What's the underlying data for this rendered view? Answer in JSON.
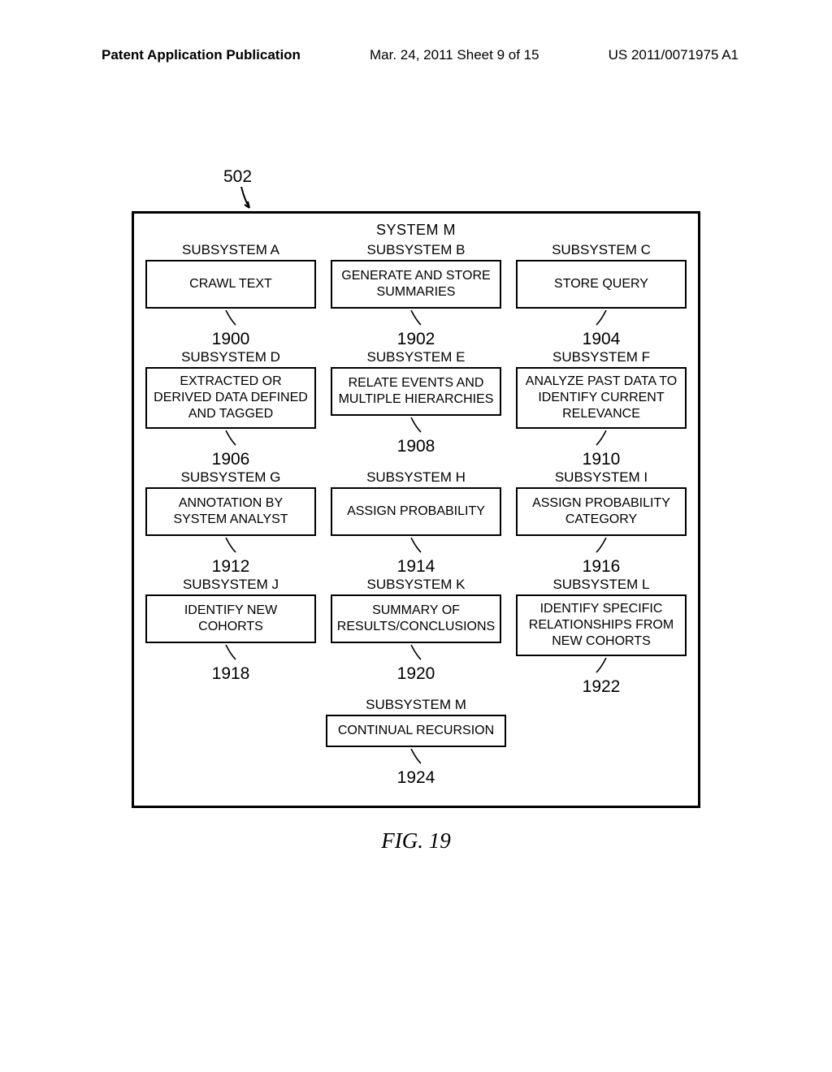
{
  "header": {
    "left": "Patent Application Publication",
    "center": "Mar. 24, 2011  Sheet 9 of 15",
    "right": "US 2011/0071975 A1"
  },
  "top_ref": "502",
  "system_title": "SYSTEM M",
  "rows": [
    [
      {
        "title": "SUBSYSTEM A",
        "body": "CRAWL TEXT",
        "ref": "1900",
        "dir": "left"
      },
      {
        "title": "SUBSYSTEM B",
        "body": "GENERATE AND STORE SUMMARIES",
        "ref": "1902",
        "dir": "left"
      },
      {
        "title": "SUBSYSTEM C",
        "body": "STORE QUERY",
        "ref": "1904",
        "dir": "right"
      }
    ],
    [
      {
        "title": "SUBSYSTEM D",
        "body": "EXTRACTED OR DERIVED DATA DEFINED AND TAGGED",
        "ref": "1906",
        "dir": "left"
      },
      {
        "title": "SUBSYSTEM E",
        "body": "RELATE EVENTS AND MULTIPLE HIERARCHIES",
        "ref": "1908",
        "dir": "left"
      },
      {
        "title": "SUBSYSTEM F",
        "body": "ANALYZE PAST DATA TO IDENTIFY CURRENT RELEVANCE",
        "ref": "1910",
        "dir": "right"
      }
    ],
    [
      {
        "title": "SUBSYSTEM G",
        "body": "ANNOTATION BY SYSTEM ANALYST",
        "ref": "1912",
        "dir": "left"
      },
      {
        "title": "SUBSYSTEM H",
        "body": "ASSIGN PROBABILITY",
        "ref": "1914",
        "dir": "left"
      },
      {
        "title": "SUBSYSTEM I",
        "body": "ASSIGN PROBABILITY CATEGORY",
        "ref": "1916",
        "dir": "right"
      }
    ],
    [
      {
        "title": "SUBSYSTEM J",
        "body": "IDENTIFY NEW COHORTS",
        "ref": "1918",
        "dir": "left"
      },
      {
        "title": "SUBSYSTEM K",
        "body": "SUMMARY OF RESULTS/CONCLUSIONS",
        "ref": "1920",
        "dir": "left"
      },
      {
        "title": "SUBSYSTEM L",
        "body": "IDENTIFY SPECIFIC RELATIONSHIPS FROM NEW COHORTS",
        "ref": "1922",
        "dir": "right"
      }
    ]
  ],
  "last": {
    "title": "SUBSYSTEM M",
    "body": "CONTINUAL RECURSION",
    "ref": "1924",
    "dir": "left"
  },
  "figure_caption": "FIG. 19"
}
